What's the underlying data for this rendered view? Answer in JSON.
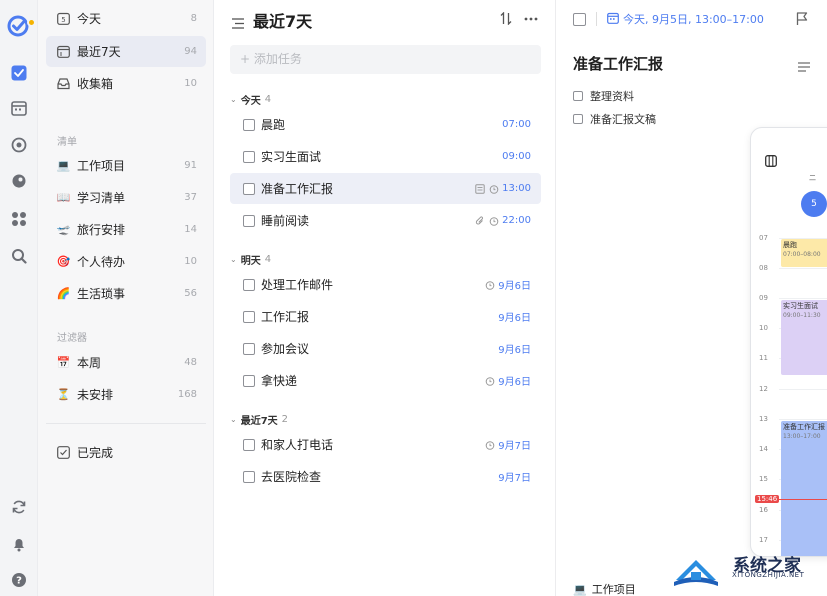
{
  "sidebar": {
    "smart": [
      {
        "label": "今天",
        "count": "8",
        "icon": "calendar-5-icon"
      },
      {
        "label": "最近7天",
        "count": "94",
        "icon": "calendar-week-icon"
      },
      {
        "label": "收集箱",
        "count": "10",
        "icon": "inbox-icon"
      }
    ],
    "lists_header": "清单",
    "lists": [
      {
        "emoji": "💻",
        "label": "工作项目",
        "count": "91"
      },
      {
        "emoji": "📖",
        "label": "学习清单",
        "count": "37"
      },
      {
        "emoji": "🛫",
        "label": "旅行安排",
        "count": "14"
      },
      {
        "emoji": "🎯",
        "label": "个人待办",
        "count": "10"
      },
      {
        "emoji": "🌈",
        "label": "生活琐事",
        "count": "56"
      }
    ],
    "filters_header": "过滤器",
    "filters": [
      {
        "emoji": "📅",
        "label": "本周",
        "count": "48"
      },
      {
        "emoji": "⏳",
        "label": "未安排",
        "count": "168"
      }
    ],
    "completed": "已完成"
  },
  "list": {
    "title": "最近7天",
    "add_placeholder": "+ 添加任务",
    "groups": [
      {
        "name": "今天",
        "count": "4"
      },
      {
        "name": "明天",
        "count": "4"
      },
      {
        "name": "最近7天",
        "count": "2"
      }
    ],
    "tasks": [
      {
        "title": "晨跑",
        "time": "07:00"
      },
      {
        "title": "实习生面试",
        "time": "09:00"
      },
      {
        "title": "准备工作汇报",
        "time": "13:00"
      },
      {
        "title": "睡前阅读",
        "time": "22:00"
      },
      {
        "title": "处理工作邮件",
        "time": "9月6日"
      },
      {
        "title": "工作汇报",
        "time": "9月6日"
      },
      {
        "title": "参加会议",
        "time": "9月6日"
      },
      {
        "title": "拿快递",
        "time": "9月6日"
      },
      {
        "title": "和家人打电话",
        "time": "9月7日"
      },
      {
        "title": "去医院检查",
        "time": "9月7日"
      }
    ]
  },
  "detail": {
    "date": "今天, 9月5日, 13:00–17:00",
    "title": "准备工作汇报",
    "subtasks": [
      "整理资料",
      "准备汇报文稿"
    ],
    "footer_emoji": "💻",
    "footer_list": "工作项目",
    "calendar": {
      "weekday": "二",
      "day": "5",
      "hours": [
        "07",
        "08",
        "09",
        "10",
        "11",
        "12",
        "13",
        "14",
        "15",
        "16",
        "17"
      ],
      "now": "15:46",
      "events": [
        {
          "title": "晨跑",
          "time": "07:00–08:00"
        },
        {
          "title": "实习生面试",
          "time": "09:00–11:30"
        },
        {
          "title": "准备工作汇报",
          "time": "13:00–17:00"
        }
      ]
    }
  },
  "watermark": {
    "title": "系统之家",
    "url": "XITONGZHIJIA.NET"
  },
  "colors": {
    "accent": "#4d7cf0",
    "alarm_red": "#ea4a4a",
    "event_yellow": "#fde9a8",
    "event_purple": "#dcd0f5",
    "event_blue": "#a9c0f7"
  }
}
